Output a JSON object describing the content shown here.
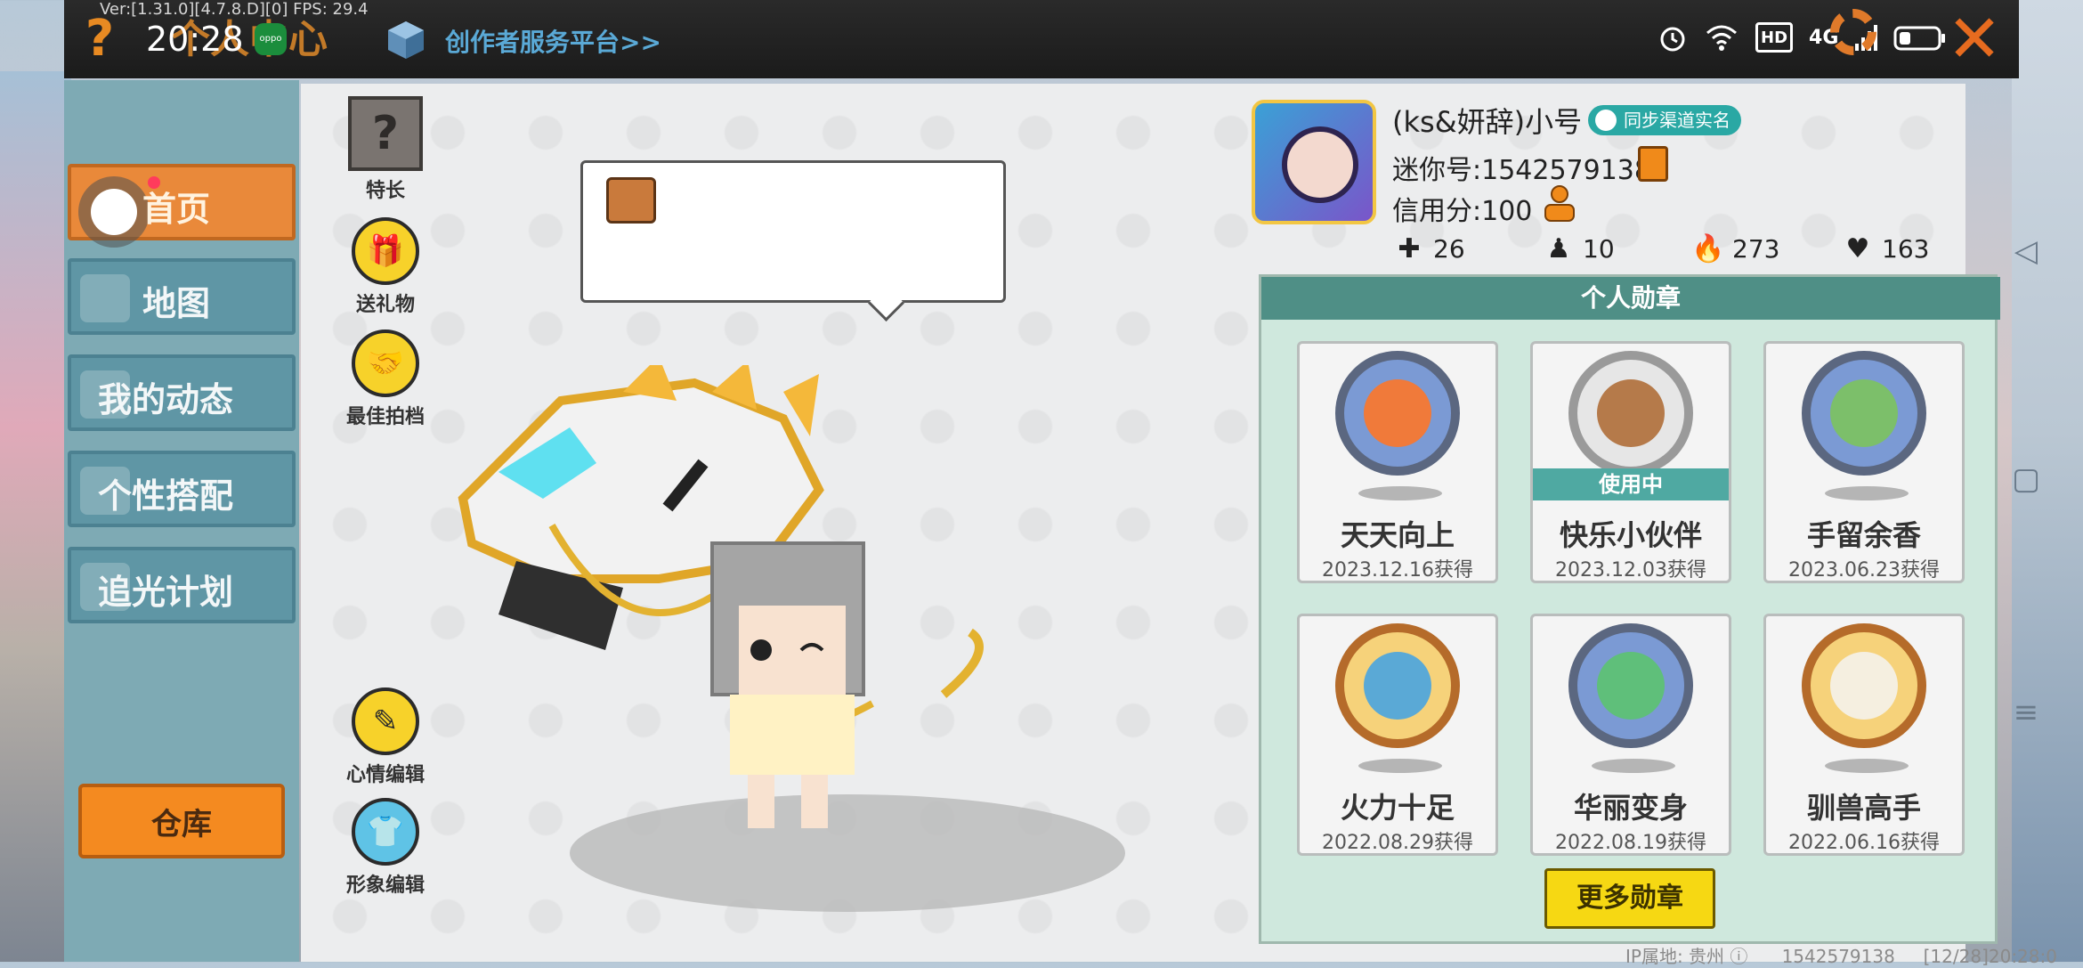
{
  "topbar": {
    "version": "Ver:[1.31.0][4.7.8.D][0] FPS: 29.4",
    "clock": "20:28",
    "oppo_label": "oppo",
    "page_title": "个人中心",
    "creator_link": "创作者服务平台>>",
    "status": {
      "hd": "HD",
      "network": "4G"
    }
  },
  "leftnav": {
    "items": [
      {
        "label": "首页",
        "active": true
      },
      {
        "label": "地图"
      },
      {
        "label": "我的动态"
      },
      {
        "label": "个性搭配"
      },
      {
        "label": "追光计划"
      }
    ],
    "warehouse": "仓库"
  },
  "actions": {
    "specialty": "特长",
    "gift": "送礼物",
    "best_photo": "最佳拍档",
    "mood_edit": "心情编辑",
    "avatar_edit": "形象编辑"
  },
  "profile": {
    "nickname": "(ks&妍辞)小号",
    "realname_badge": "同步渠道实名",
    "mini_id": "迷你号:1542579138",
    "credit": "信用分:100",
    "stats": [
      {
        "icon": "add-friend-icon",
        "value": "26"
      },
      {
        "icon": "fans-icon",
        "value": "10"
      },
      {
        "icon": "flame-icon",
        "value": "273"
      },
      {
        "icon": "heart-icon",
        "value": "163"
      }
    ]
  },
  "medals": {
    "title": "个人勋章",
    "items": [
      {
        "name": "天天向上",
        "date": "2023.12.16获得",
        "style": "blue-orange"
      },
      {
        "name": "快乐小伙伴",
        "date": "2023.12.03获得",
        "style": "silver",
        "badge": "使用中"
      },
      {
        "name": "手留余香",
        "date": "2023.06.23获得",
        "style": "blue-green"
      },
      {
        "name": "火力十足",
        "date": "2022.08.29获得",
        "style": "gold"
      },
      {
        "name": "华丽变身",
        "date": "2022.08.19获得",
        "style": "blue-green"
      },
      {
        "name": "驯兽高手",
        "date": "2022.06.16获得",
        "style": "gold"
      }
    ],
    "more_button": "更多勋章"
  },
  "footer": {
    "ip_location": "IP属地: 贵州",
    "uid": "1542579138",
    "timestamp": "[12/28]20:28:0"
  }
}
